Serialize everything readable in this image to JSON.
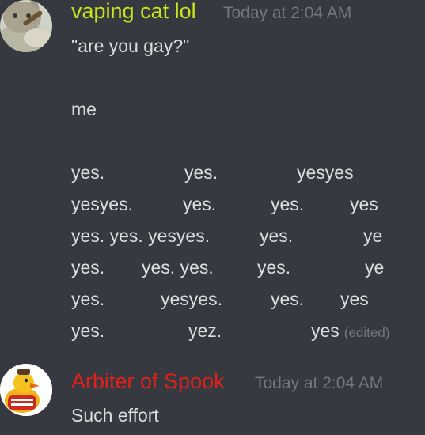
{
  "messages": [
    {
      "username": "vaping cat lol",
      "username_color": "#c9e51a",
      "timestamp": "Today at 2:04 AM",
      "avatar_icon": "cat-avatar",
      "lines": [
        "\"are you gay?\"",
        "me"
      ],
      "grid": [
        [
          "yes.",
          "yes.",
          "yesyes"
        ],
        [
          "yesyes.",
          "yes.",
          "yes.",
          "yes"
        ],
        [
          "yes. yes. yesyes.",
          "yes.",
          "ye"
        ],
        [
          "yes.",
          "yes. yes.",
          "yes.",
          "ye"
        ],
        [
          "yes.",
          "yesyes.",
          "yes.",
          "yes"
        ],
        [
          "yes.",
          "yez.",
          "yes"
        ]
      ],
      "edited_label": "(edited)"
    },
    {
      "username": "Arbiter of Spook",
      "username_color": "#e0201a",
      "timestamp": "Today at 2:04 AM",
      "avatar_icon": "duck-avatar",
      "lines": [
        "Such effort"
      ]
    }
  ]
}
